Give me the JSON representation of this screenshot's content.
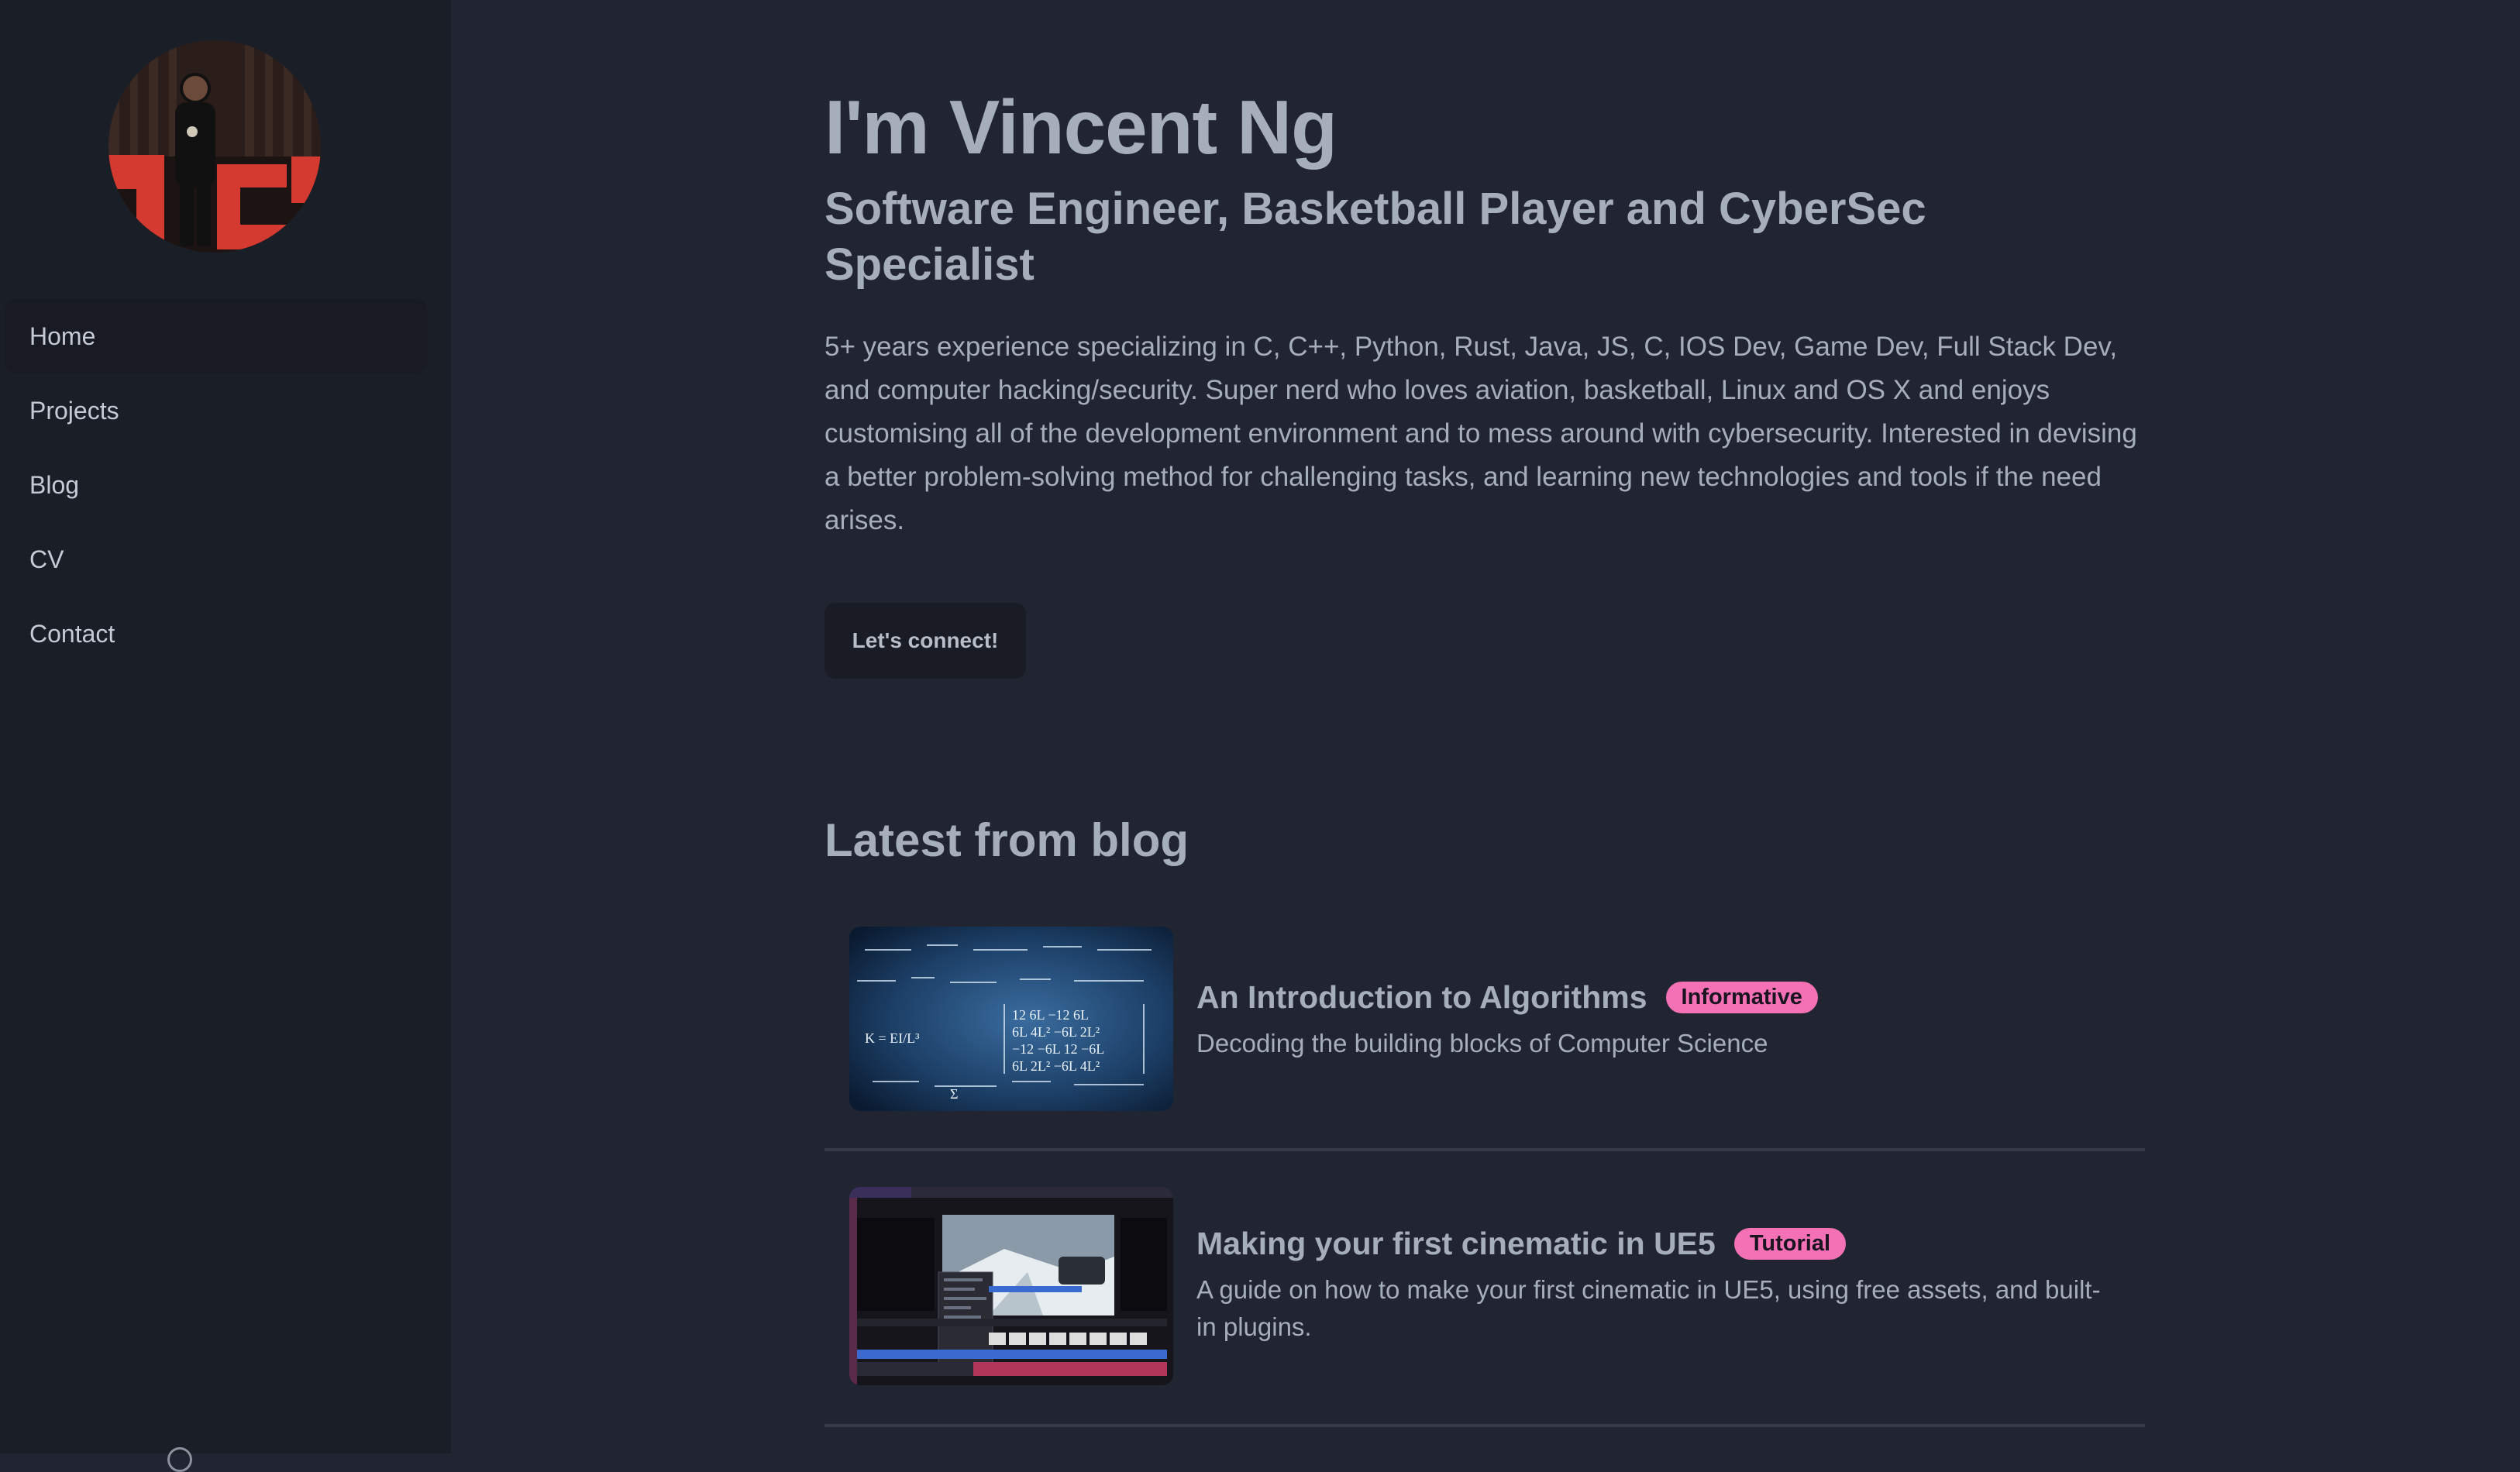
{
  "sidebar": {
    "avatar_alt": "Vincent Ng speaking on stage",
    "items": [
      {
        "label": "Home",
        "active": true
      },
      {
        "label": "Projects"
      },
      {
        "label": "Blog"
      },
      {
        "label": "CV"
      },
      {
        "label": "Contact"
      }
    ]
  },
  "hero": {
    "title": "I'm Vincent Ng",
    "subtitle": "Software Engineer, Basketball Player and CyberSec Specialist",
    "description": "5+ years experience specializing in C, C++, Python, Rust, Java, JS, C, IOS Dev, Game Dev, Full Stack Dev, and computer hacking/security. Super nerd who loves aviation, basketball, Linux and OS X and enjoys customising all of the development environment and to mess around with cybersecurity. Interested in devising a better problem-solving method for challenging tasks, and learning new technologies and tools if the need arises.",
    "cta_label": "Let's connect!"
  },
  "blog": {
    "section_title": "Latest from blog",
    "posts": [
      {
        "title": "An Introduction to Algorithms",
        "badge": "Informative",
        "description": "Decoding the building blocks of Computer Science"
      },
      {
        "title": "Making your first cinematic in UE5",
        "badge": "Tutorial",
        "description": "A guide on how to make your first cinematic in UE5, using free assets, and built-in plugins."
      }
    ]
  },
  "colors": {
    "background": "#202531",
    "sidebar": "#1a1e27",
    "text": "#a6adbb",
    "badge": "#f471b5"
  }
}
